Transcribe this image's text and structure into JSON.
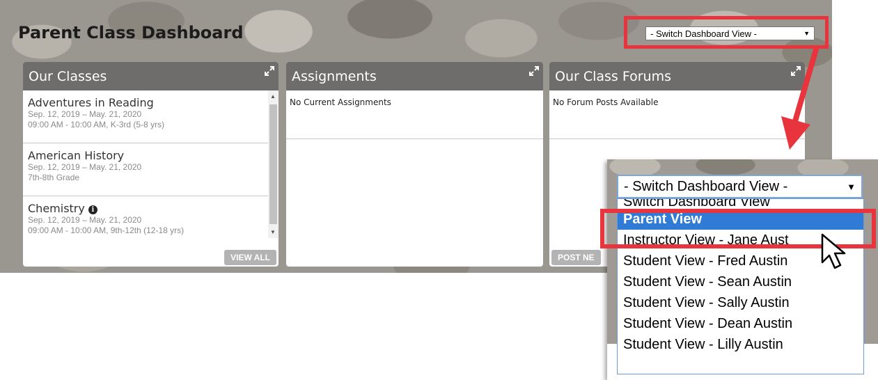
{
  "page": {
    "title": "Parent Class Dashboard"
  },
  "switcher": {
    "label": "- Switch Dashboard View -"
  },
  "widgets": {
    "classes": {
      "title": "Our Classes",
      "items": [
        {
          "name": "Adventures in Reading",
          "dates": "Sep. 12, 2019 – May. 21, 2020",
          "details": "09:00 AM - 10:00 AM, K-3rd (5-8 yrs)"
        },
        {
          "name": "American History",
          "dates": "Sep. 12, 2019 – May. 21, 2020",
          "details": "7th-8th Grade"
        },
        {
          "name": "Chemistry",
          "dates": "Sep. 12, 2019 – May. 21, 2020",
          "details": "09:00 AM - 10:00 AM, 9th-12th (12-18 yrs)"
        }
      ],
      "footer_button": "VIEW ALL"
    },
    "assignments": {
      "title": "Assignments",
      "empty_text": "No Current Assignments"
    },
    "forums": {
      "title": "Our Class Forums",
      "empty_text": "No Forum Posts Available",
      "footer_button": "POST NE"
    }
  },
  "zoom_dropdown": {
    "selected": "- Switch Dashboard View -",
    "partial_top": "Switch Dashboard View",
    "options": [
      "Parent View",
      "Instructor View - Jane Aust",
      "Student View - Fred Austin",
      "Student View - Sean Austin",
      "Student View - Sally Austin",
      "Student View - Dean Austin",
      "Student View - Lilly Austin"
    ]
  },
  "colors": {
    "highlight": "#e8343c",
    "selected_option": "#2f7bd5",
    "widget_header": "#6e6d6b"
  }
}
